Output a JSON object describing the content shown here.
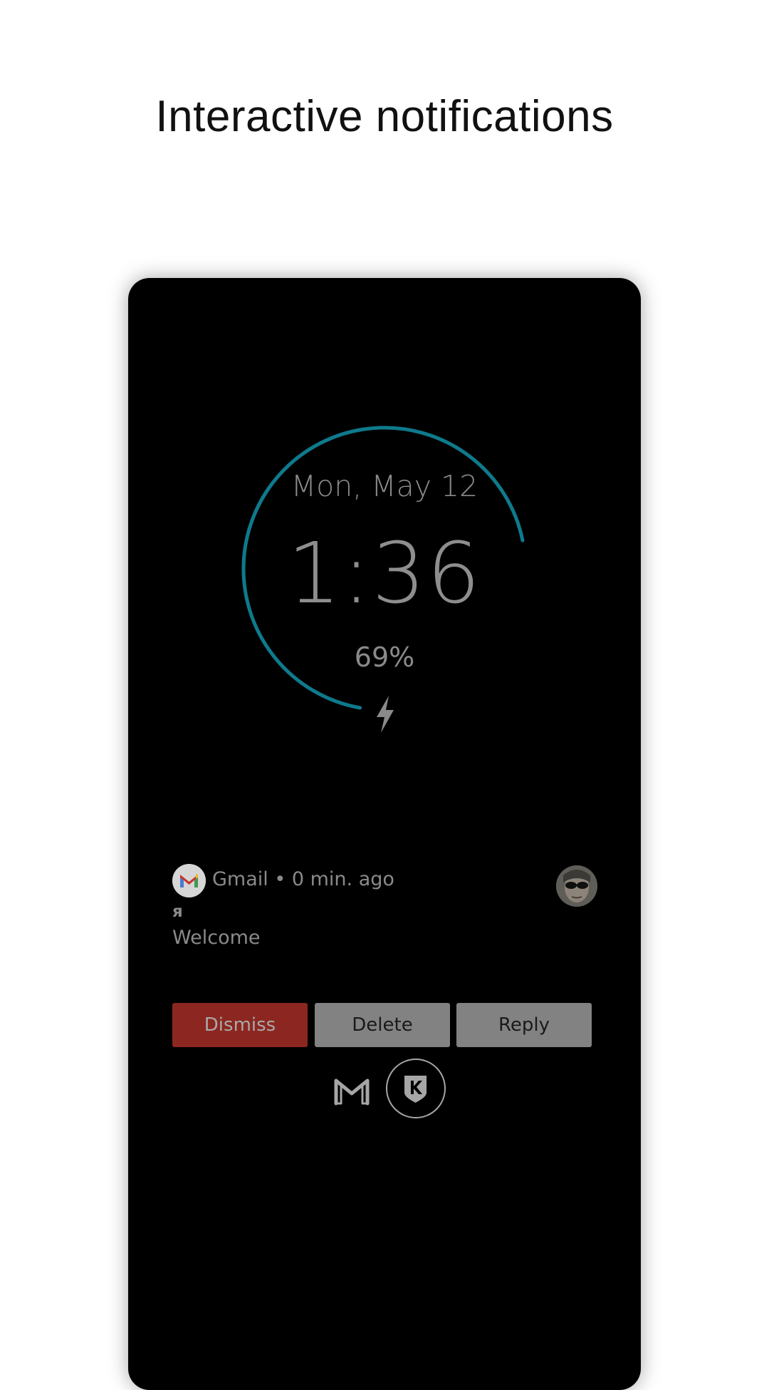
{
  "page": {
    "title": "Interactive notifications"
  },
  "lockscreen": {
    "date": "Mon, May 12",
    "time": "1:36",
    "battery": "69%",
    "battery_level": 0.69,
    "charging": true,
    "ring_color": "#0e7a8c",
    "charging_icon": "bolt-icon"
  },
  "notification": {
    "app_icon": "gmail-icon",
    "header": "Gmail • 0 min. ago",
    "sender": "я",
    "text": "Welcome",
    "avatar": "avatar-photo",
    "actions": {
      "dismiss": "Dismiss",
      "delete": "Delete",
      "reply": "Reply"
    },
    "dismiss_color": "#8c2620",
    "button_color": "#828282"
  },
  "shortcuts": [
    {
      "icon": "gmail-outline-icon"
    },
    {
      "icon": "k-shield-icon"
    }
  ]
}
